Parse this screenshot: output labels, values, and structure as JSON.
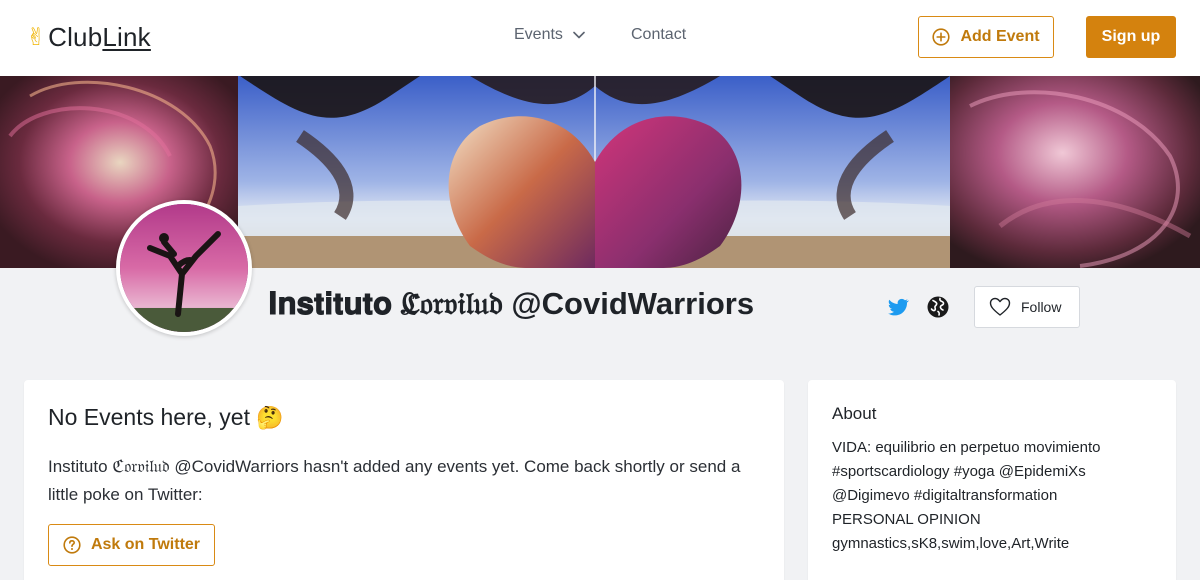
{
  "header": {
    "logo_prefix": "Club",
    "logo_suffix": "Link",
    "logo_icon": "victory-hand-icon",
    "nav": {
      "events_label": "Events",
      "contact_label": "Contact"
    },
    "add_event_label": "Add Event",
    "sign_up_label": "Sign up"
  },
  "profile": {
    "name": "𝐈𝐧𝐬𝐭𝐢𝐭𝐮𝐭𝐨 ℭ𝔬𝔯𝔳𝔦𝔩𝔲𝔡 @CovidWarriors",
    "follow_label": "Follow",
    "social_icons": [
      "twitter-icon",
      "globe-icon"
    ]
  },
  "events": {
    "empty_title": "No Events here, yet",
    "empty_emoji": "🤔",
    "empty_message": "Instituto ℭ𝔬𝔯𝔳𝔦𝔩𝔲𝔡 @CovidWarriors hasn't added any events yet. Come back shortly or send a little poke on Twitter:",
    "ask_label": "Ask on Twitter"
  },
  "about": {
    "title": "About",
    "lines": [
      "VIDA: equilibrio en perpetuo movimiento",
      "#sportscardiology #yoga @EpidemiXs",
      "@Digimevo #digitaltransformation",
      "PERSONAL OPINION",
      "gymnastics,sK8,swim,love,Art,Write"
    ]
  },
  "colors": {
    "accent": "#d4820e",
    "accent_text": "#c07a0c",
    "twitter": "#1d9bf0",
    "page_bg": "#f1f2f4"
  }
}
